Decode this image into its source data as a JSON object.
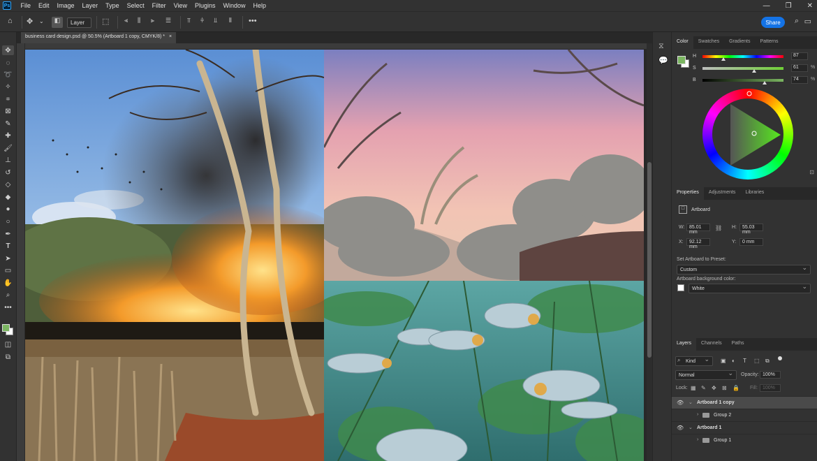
{
  "app": {
    "logo": "Ps",
    "menu": [
      "File",
      "Edit",
      "Image",
      "Layer",
      "Type",
      "Select",
      "Filter",
      "View",
      "Plugins",
      "Window",
      "Help"
    ]
  },
  "options_bar": {
    "layer_select": "Layer",
    "share_label": "Share"
  },
  "document": {
    "tab_title": "business card design.psd @ 50.5% (Artboard 1 copy, CMYK/8) *",
    "tab_close": "×"
  },
  "color_panel": {
    "tabs": [
      "Color",
      "Swatches",
      "Gradients",
      "Patterns"
    ],
    "h_label": "H",
    "h_value": "87",
    "s_label": "S",
    "s_value": "61",
    "b_label": "B",
    "b_value": "74",
    "pct": "%",
    "foreground_color": "#7bb661",
    "background_color": "#ffffff"
  },
  "properties_panel": {
    "tabs": [
      "Properties",
      "Adjustments",
      "Libraries"
    ],
    "type_label": "Artboard",
    "w_label": "W:",
    "w_value": "85.01 mm",
    "h_label": "H:",
    "h_value": "55.03 mm",
    "x_label": "X:",
    "x_value": "92.12 mm",
    "y_label": "Y:",
    "y_value": "0 mm",
    "preset_label": "Set Artboard to Preset:",
    "preset_value": "Custom",
    "bg_label": "Artboard background color:",
    "bg_value": "White"
  },
  "layers_panel": {
    "tabs": [
      "Layers",
      "Channels",
      "Paths"
    ],
    "filter_kind": "Kind",
    "blend_mode": "Normal",
    "opacity_label": "Opacity:",
    "opacity_value": "100%",
    "lock_label": "Lock:",
    "fill_label": "Fill:",
    "fill_value": "100%",
    "layers": [
      {
        "name": "Artboard 1 copy",
        "type": "artboard",
        "visible": true,
        "selected": true
      },
      {
        "name": "Group 2",
        "type": "group",
        "visible": false,
        "selected": false
      },
      {
        "name": "Artboard 1",
        "type": "artboard",
        "visible": true,
        "selected": false
      },
      {
        "name": "Group 1",
        "type": "group",
        "visible": false,
        "selected": false
      }
    ]
  }
}
